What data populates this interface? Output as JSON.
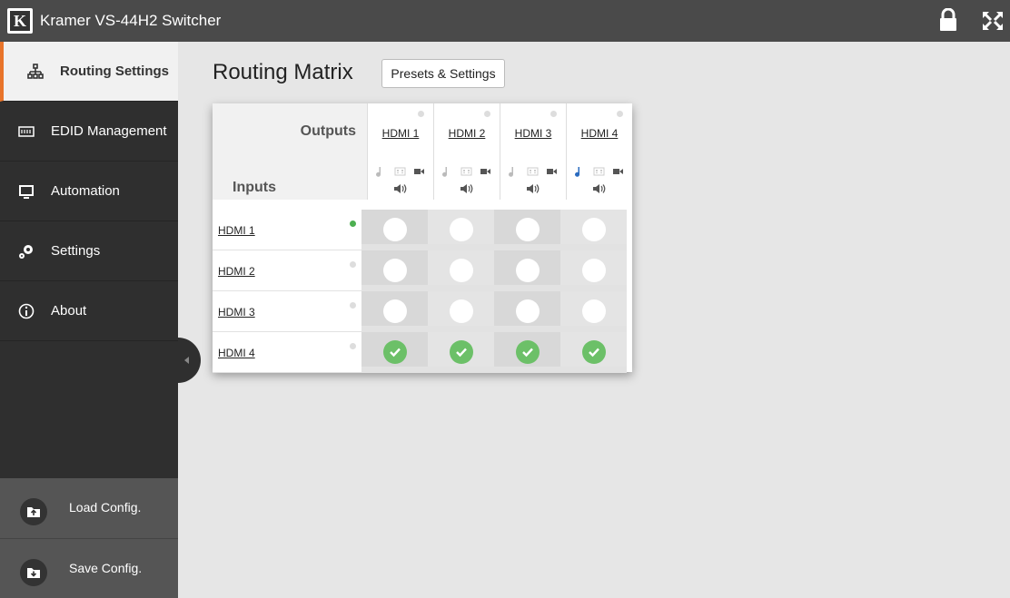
{
  "app": {
    "title": "Kramer VS-44H2 Switcher",
    "logo_text": "K"
  },
  "topbar": {
    "lock_icon": "lock-icon",
    "fullscreen_icon": "fullscreen-icon"
  },
  "sidebar": {
    "items": [
      {
        "label": "Routing Settings",
        "icon": "network-tree-icon",
        "active": true
      },
      {
        "label": "EDID Management",
        "icon": "edid-chip-icon",
        "active": false
      },
      {
        "label": "Automation",
        "icon": "monitor-icon",
        "active": false
      },
      {
        "label": "Settings",
        "icon": "gears-icon",
        "active": false
      },
      {
        "label": "About",
        "icon": "info-icon",
        "active": false
      }
    ],
    "load_config": "Load Config.",
    "save_config": "Save Config."
  },
  "main": {
    "title": "Routing Matrix",
    "presets_button": "Presets & Settings"
  },
  "matrix": {
    "outputs_label": "Outputs",
    "inputs_label": "Inputs",
    "outputs": [
      {
        "name": "HDMI 1",
        "audio_active": false
      },
      {
        "name": "HDMI 2",
        "audio_active": false
      },
      {
        "name": "HDMI 3",
        "audio_active": false
      },
      {
        "name": "HDMI 4",
        "audio_active": true
      }
    ],
    "inputs": [
      {
        "name": "HDMI 1",
        "signal": true
      },
      {
        "name": "HDMI 2",
        "signal": false
      },
      {
        "name": "HDMI 3",
        "signal": false
      },
      {
        "name": "HDMI 4",
        "signal": false
      }
    ],
    "routing": [
      [
        false,
        false,
        false,
        false
      ],
      [
        false,
        false,
        false,
        false
      ],
      [
        false,
        false,
        false,
        false
      ],
      [
        true,
        true,
        true,
        true
      ]
    ],
    "colors": {
      "signal_on": "#4caf50",
      "signal_off": "#dddddd",
      "route_on": "#6cc068",
      "audio_active": "#2a6bbf",
      "accent": "#e8742a"
    }
  }
}
